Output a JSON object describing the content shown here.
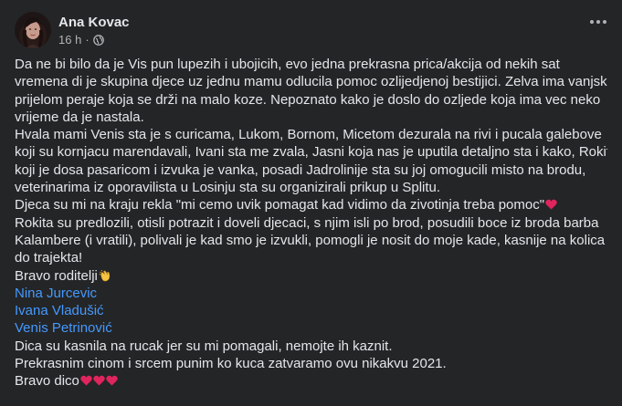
{
  "post": {
    "author": "Ana Kovac",
    "time": "16 h",
    "dot": "·",
    "privacy_icon": "globe-icon",
    "more_icon": "more-horizontal-icon",
    "lines": [
      "Da ne bi bilo da je Vis pun lupezih i ubojicih, evo jedna prekrasna prica/akcija od nekih sat",
      "vremena di je skupina djece uz jednu mamu odlucila pomoc ozlijedjenoj bestijici. Zelva ima vanjski",
      "prijelom peraje koja se drži na malo koze. Nepoznato kako je doslo do ozljede koja ima vec neko",
      "vrijeme da je nastala.",
      "Hvala mami Venis sta je s curicama, Lukom, Bornom, Micetom dezurala na rivi i pucala galebove",
      "koji su kornjacu marendavali, Ivani sta me zvala, Jasni koja nas je uputila detaljno sta i kako, Rokitu",
      "koji je dosa pasaricom i izvuka je vanka, posadi Jadrolinije sta su joj omogucili misto na brodu,",
      "veterinarima iz oporavilista u Losinju sta su organizirali prikup u Splitu.",
      "Djeca su mi na kraju rekla \"mi cemo uvik pomagat kad vidimo da zivotinja treba pomoc\"",
      "Rokita su predlozili, otisli potrazit i doveli djecaci, s njim isli po brod, posudili boce iz broda barba",
      "Kalambere (i vratili), polivali je kad smo je izvukli, pomogli je nosit do moje kade, kasnije na kolica",
      "do trajekta!",
      "Bravo roditelji"
    ],
    "tags": [
      "Nina Jurcevic",
      "Ivana Vladušić",
      "Venis Petrinović"
    ],
    "closing": [
      "Dica su kasnila na rucak jer su mi pomagali, nemojte ih kaznit.",
      "Prekrasnim cinom i srcem punim ko kuca zatvaramo ovu nikakvu 2021.",
      "Bravo dico"
    ],
    "emoji": {
      "heart": "red-heart-icon",
      "clap": "clapping-hands-icon"
    },
    "colors": {
      "background": "#242526",
      "text": "#e4e6eb",
      "secondary": "#b0b3b8",
      "link": "#4599ff",
      "heart": "#e0245e",
      "clap": "#f5c542"
    }
  }
}
